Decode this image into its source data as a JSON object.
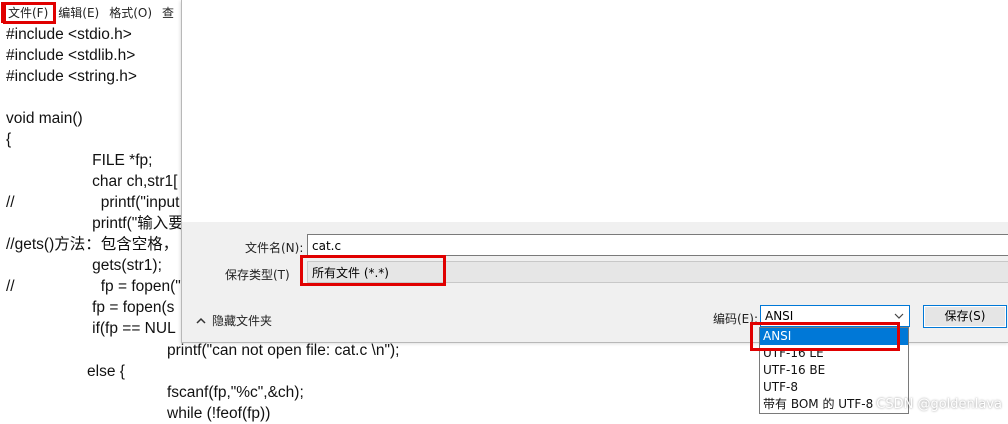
{
  "notepad": {
    "menu": [
      "文件(F)",
      "编辑(E)",
      "格式(O)",
      "查"
    ],
    "code_lines_left": [
      "#include <stdio.h>",
      "#include <stdlib.h>",
      "#include <string.h>",
      "",
      "void main()",
      "{",
      "\t\tFILE *fp;",
      "\t\tchar ch,str1[",
      "//\t\tprintf(\"input",
      "\t\tprintf(\"输入要",
      "//gets()方法：包含空格，",
      "\t\tgets(str1);",
      "//\t\tfp = fopen(\"",
      "\t\tfp = fopen(s",
      "\t\tif(fp == NUL"
    ],
    "code_lines_bottom": [
      "printf(\"can not open file: cat.c \\n\");",
      "else {",
      "fscanf(fp,\"%c\",&ch);",
      "while (!feof(fp))"
    ]
  },
  "dialog": {
    "filename_label": "文件名(N):",
    "filename_value": "cat.c",
    "filetype_label": "保存类型(T)",
    "filetype_value": "所有文件  (*.*)",
    "hide_folders": "隐藏文件夹",
    "encoding_label": "编码(E):",
    "encoding_value": "ANSI",
    "save_label": "保存(S)",
    "encoding_options": [
      "ANSI",
      "UTF-16 LE",
      "UTF-16 BE",
      "UTF-8",
      "带有 BOM 的 UTF-8"
    ]
  },
  "watermark": "CSDN @goldenlava",
  "colors": {
    "accent": "#0078d7",
    "annotation": "#e00000"
  }
}
